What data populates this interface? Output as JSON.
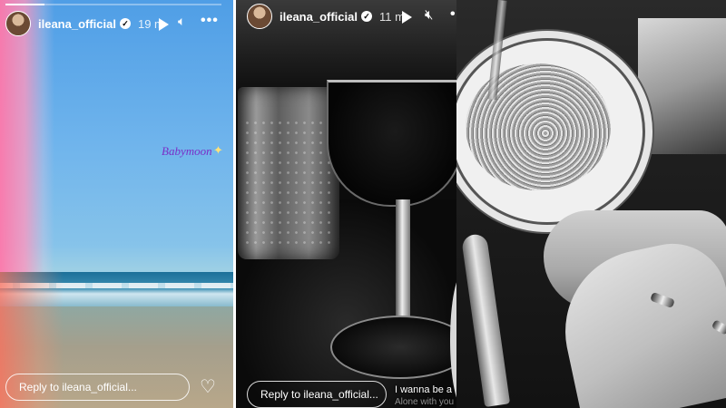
{
  "stories": [
    {
      "username": "ileana_official",
      "time": "19 m",
      "sticker": "Babymoon",
      "reply_placeholder": "Reply to ileana_official...",
      "progress": 0.18
    },
    {
      "username": "ileana_official",
      "time": "11 m",
      "reply_placeholder": "Reply to ileana_official...",
      "lyric_line_1": "I wanna be a",
      "lyric_line_2": "Alone with you"
    },
    {
      "image": "black-and-white pasta dinner with hands and rings"
    }
  ],
  "icons": {
    "play": "play-icon",
    "mute": "mute-icon",
    "more": "more-icon",
    "verified": "verified-badge-icon",
    "like": "heart-icon"
  },
  "colors": {
    "sticker": "#7a2fc7",
    "overlay_text": "#ffffff"
  }
}
